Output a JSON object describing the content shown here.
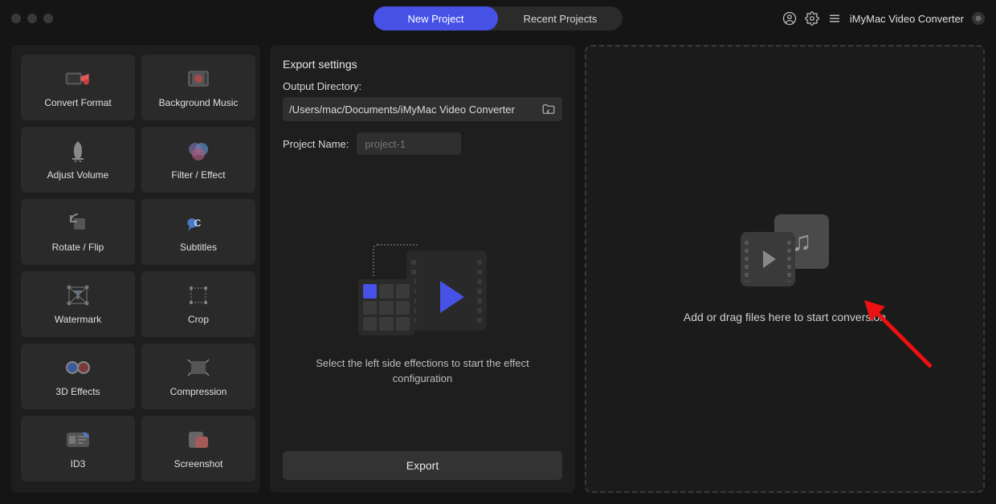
{
  "app_name": "iMyMac Video Converter",
  "tabs": {
    "new_project": "New Project",
    "recent_projects": "Recent Projects"
  },
  "sidebar": {
    "tools": [
      {
        "id": "convert-format",
        "label": "Convert Format"
      },
      {
        "id": "background-music",
        "label": "Background Music"
      },
      {
        "id": "adjust-volume",
        "label": "Adjust Volume"
      },
      {
        "id": "filter-effect",
        "label": "Filter / Effect"
      },
      {
        "id": "rotate-flip",
        "label": "Rotate / Flip"
      },
      {
        "id": "subtitles",
        "label": "Subtitles"
      },
      {
        "id": "watermark",
        "label": "Watermark"
      },
      {
        "id": "crop",
        "label": "Crop"
      },
      {
        "id": "3d-effects",
        "label": "3D Effects"
      },
      {
        "id": "compression",
        "label": "Compression"
      },
      {
        "id": "id3",
        "label": "ID3"
      },
      {
        "id": "screenshot",
        "label": "Screenshot"
      }
    ]
  },
  "export": {
    "title": "Export settings",
    "dir_label": "Output Directory:",
    "dir_value": "/Users/mac/Documents/iMyMac Video Converter",
    "name_label": "Project Name:",
    "name_placeholder": "project-1",
    "hint": "Select the left side effections to start the effect configuration",
    "button": "Export"
  },
  "drop": {
    "hint": "Add or drag files here to start conversion"
  }
}
